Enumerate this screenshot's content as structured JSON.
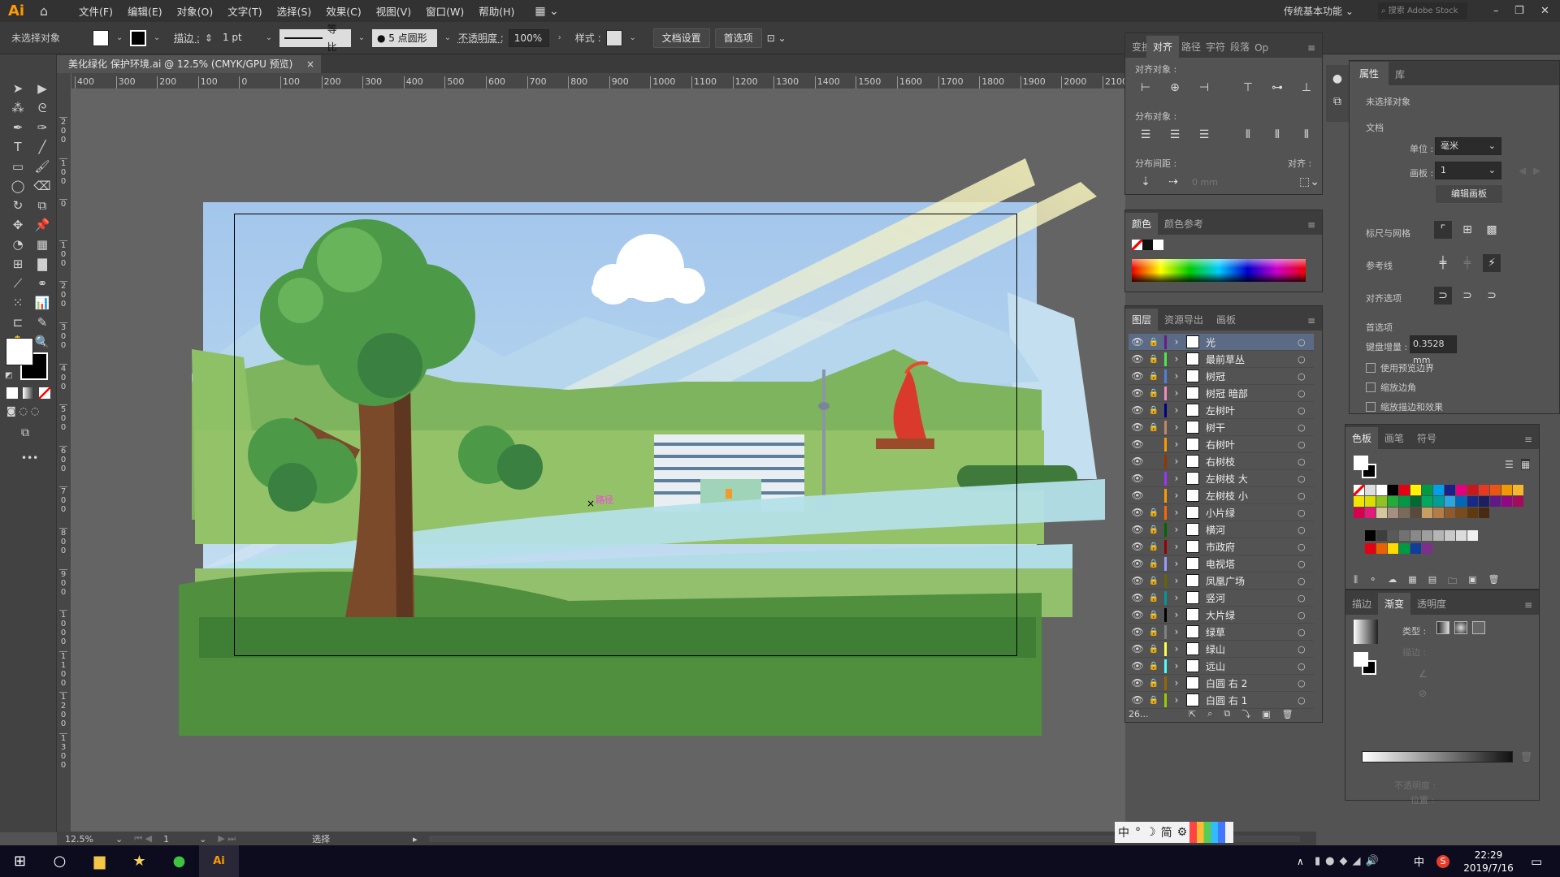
{
  "app": {
    "logo": "Ai",
    "menu": [
      "文件(F)",
      "编辑(E)",
      "对象(O)",
      "文字(T)",
      "选择(S)",
      "效果(C)",
      "视图(V)",
      "窗口(W)",
      "帮助(H)"
    ],
    "workspace": "传统基本功能",
    "search_placeholder": "搜索 Adobe Stock"
  },
  "control": {
    "selection": "未选择对象",
    "stroke_label": "描边 :",
    "stroke_value": "1 pt",
    "profile": "等比",
    "brush": "● 5 点圆形",
    "opacity_label": "不透明度 :",
    "opacity_value": "100%",
    "style_label": "样式 :",
    "doc_setup": "文档设置",
    "prefs": "首选项"
  },
  "document": {
    "tab_title": "美化绿化 保护环境.ai @ 12.5% (CMYK/GPU 预览)",
    "canvas_label": "路径"
  },
  "ruler": {
    "top": [
      "400",
      "300",
      "200",
      "100",
      "0",
      "100",
      "200",
      "300",
      "400",
      "500",
      "600",
      "700",
      "800",
      "900",
      "1000",
      "1100",
      "1200",
      "1300",
      "1400",
      "1500",
      "1600",
      "1700",
      "1800",
      "1900",
      "2000",
      "2100"
    ],
    "left": [
      "200",
      "100",
      "0",
      "100",
      "200",
      "300",
      "400",
      "500",
      "600",
      "700",
      "800",
      "900",
      "1000",
      "1100",
      "1200",
      "1300"
    ]
  },
  "align_panel": {
    "tabs": [
      "变换",
      "对齐",
      "路径",
      "字符",
      "段落",
      "Op"
    ],
    "align_objects": "对齐对象 :",
    "distribute_objects": "分布对象 :",
    "distribute_spacing": "分布间距 :",
    "align_to": "对齐 :",
    "spacing_value": "0 mm"
  },
  "color_panel": {
    "tabs": [
      "颜色",
      "颜色参考"
    ]
  },
  "layers_panel": {
    "tabs": [
      "图层",
      "资源导出",
      "画板"
    ],
    "count": "26...",
    "layers": [
      {
        "name": "光",
        "color": "#6a1b8a",
        "locked": true
      },
      {
        "name": "最前草丛",
        "color": "#4de84d",
        "locked": true
      },
      {
        "name": "树冠",
        "color": "#4f7fe0",
        "locked": true
      },
      {
        "name": "树冠 暗部",
        "color": "#f08cc0",
        "locked": true
      },
      {
        "name": "左树叶",
        "color": "#000080",
        "locked": true
      },
      {
        "name": "树干",
        "color": "#c08a60",
        "locked": true
      },
      {
        "name": "右树叶",
        "color": "#ff9900",
        "locked": false
      },
      {
        "name": "右树枝",
        "color": "#993300",
        "locked": false
      },
      {
        "name": "左树枝 大",
        "color": "#9933ff",
        "locked": false
      },
      {
        "name": "左树枝 小",
        "color": "#ff9900",
        "locked": false
      },
      {
        "name": "小片绿",
        "color": "#ff6600",
        "locked": true
      },
      {
        "name": "横河",
        "color": "#006600",
        "locked": true
      },
      {
        "name": "市政府",
        "color": "#990000",
        "locked": true
      },
      {
        "name": "电视塔",
        "color": "#9999ff",
        "locked": true
      },
      {
        "name": "凤凰广场",
        "color": "#666600",
        "locked": true
      },
      {
        "name": "竖河",
        "color": "#009999",
        "locked": true
      },
      {
        "name": "大片绿",
        "color": "#000000",
        "locked": true
      },
      {
        "name": "绿草",
        "color": "#808080",
        "locked": true
      },
      {
        "name": "绿山",
        "color": "#ffff4d",
        "locked": true
      },
      {
        "name": "远山",
        "color": "#4dffff",
        "locked": true
      },
      {
        "name": "白圆 右 2",
        "color": "#996600",
        "locked": true
      },
      {
        "name": "白圆 右 1",
        "color": "#99cc00",
        "locked": true
      }
    ]
  },
  "properties": {
    "tabs": [
      "属性",
      "库"
    ],
    "no_selection": "未选择对象",
    "document": "文档",
    "units_label": "单位 :",
    "units_value": "毫米",
    "artboard_label": "画板 :",
    "artboard_value": "1",
    "edit_artboard": "编辑画板",
    "rulers_grids": "标尺与网格",
    "guides": "参考线",
    "snap_options": "对齐选项",
    "preferences": "首选项",
    "keyboard_increment_label": "键盘增量 :",
    "keyboard_increment_value": "0.3528 mm",
    "checkboxes": [
      "使用预览边界",
      "缩放边角",
      "缩放描边和效果"
    ]
  },
  "swatches_panel": {
    "tabs": [
      "色板",
      "画笔",
      "符号"
    ],
    "colors": [
      "#000000",
      "#e60012",
      "#fff100",
      "#009944",
      "#00a0e9",
      "#1d2088",
      "#e4007f",
      "#c9171e",
      "#e83820",
      "#ea5514",
      "#f39800",
      "#f8b62d",
      "#f2e600",
      "#dadf00",
      "#8fc31f",
      "#22ac38",
      "#009a44",
      "#006934",
      "#00a95f",
      "#009e96",
      "#2ca6e0",
      "#0068b7",
      "#172a88",
      "#1d1f5e",
      "#601986",
      "#920783",
      "#a40b5d",
      "#d7004f",
      "#e3197b",
      "#d6c6a0",
      "#a58f7f",
      "#7a6a58",
      "#5a4a3c",
      "#c89e62",
      "#b27d46",
      "#8f5a2e",
      "#7a4b1c",
      "#5e3a0e",
      "#4a2a12"
    ],
    "grays": [
      "#000000",
      "#3e3e3e",
      "#595959",
      "#727272",
      "#898989",
      "#9f9f9f",
      "#b5b5b5",
      "#c9c9c9",
      "#dcdcdc",
      "#efefef"
    ],
    "group": [
      "#e60012",
      "#eb6100",
      "#ffd900",
      "#009944",
      "#0f3f9a",
      "#7d2f8e"
    ]
  },
  "gradient_panel": {
    "tabs": [
      "描边",
      "渐变",
      "透明度"
    ],
    "type_label": "类型 :",
    "stroke_label": "描边 :",
    "opacity_label": "不透明度 :",
    "location_label": "位置 :"
  },
  "status": {
    "zoom": "12.5%",
    "artboard": "1",
    "tool": "选择"
  },
  "ime": {
    "items": [
      "中",
      "°",
      "☽",
      "简",
      "⚙"
    ]
  },
  "taskbar": {
    "time": "22:29",
    "date": "2019/7/16",
    "ime": "中"
  }
}
